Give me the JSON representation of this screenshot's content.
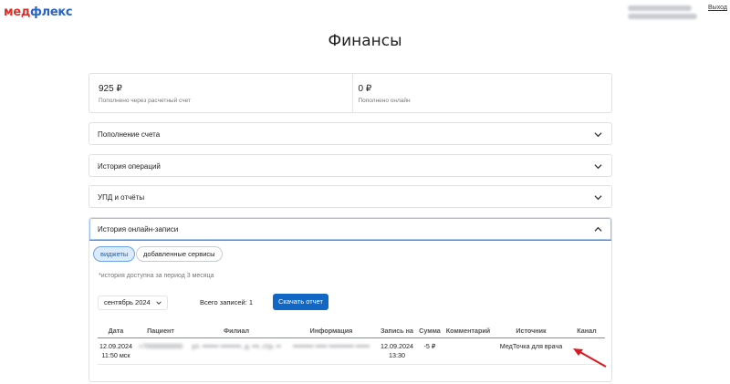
{
  "brand": {
    "logo_part1": "мед",
    "logo_part2": "флекс"
  },
  "header": {
    "logout": "Выход"
  },
  "page": {
    "title": "Финансы"
  },
  "summary": [
    {
      "value": "925 ₽",
      "label": "Пополнено через расчетный счет"
    },
    {
      "value": "0 ₽",
      "label": "Пополнено онлайн"
    }
  ],
  "accordions": [
    {
      "title": "Пополнение счета"
    },
    {
      "title": "История операций"
    },
    {
      "title": "УПД и отчёты"
    },
    {
      "title": "История онлайн-записи"
    }
  ],
  "online": {
    "tabs": [
      {
        "label": "виджеты",
        "active": true
      },
      {
        "label": "добавленные сервисы",
        "active": false
      }
    ],
    "note": "*история доступна за период 3 месяца",
    "month": "сентябрь 2024",
    "total": "Всего записей: 1",
    "download": "Скачать отчет",
    "columns": [
      "Дата",
      "Пациент",
      "Филиал",
      "Информация",
      "Запись на",
      "Сумма",
      "Комментарий",
      "Источник",
      "Канал"
    ],
    "rows": [
      {
        "date": "12.09.2024",
        "time": "11:50 мск",
        "record_date": "12.09.2024",
        "record_time": "13:30",
        "sum": "-5 ₽",
        "comment": "",
        "source": "МедТочка для врача",
        "channel": ""
      }
    ]
  },
  "colors": {
    "accent": "#1167c3",
    "brand_red": "#d9312c",
    "brand_blue": "#2a64c2",
    "annotation": "#d81b22"
  }
}
